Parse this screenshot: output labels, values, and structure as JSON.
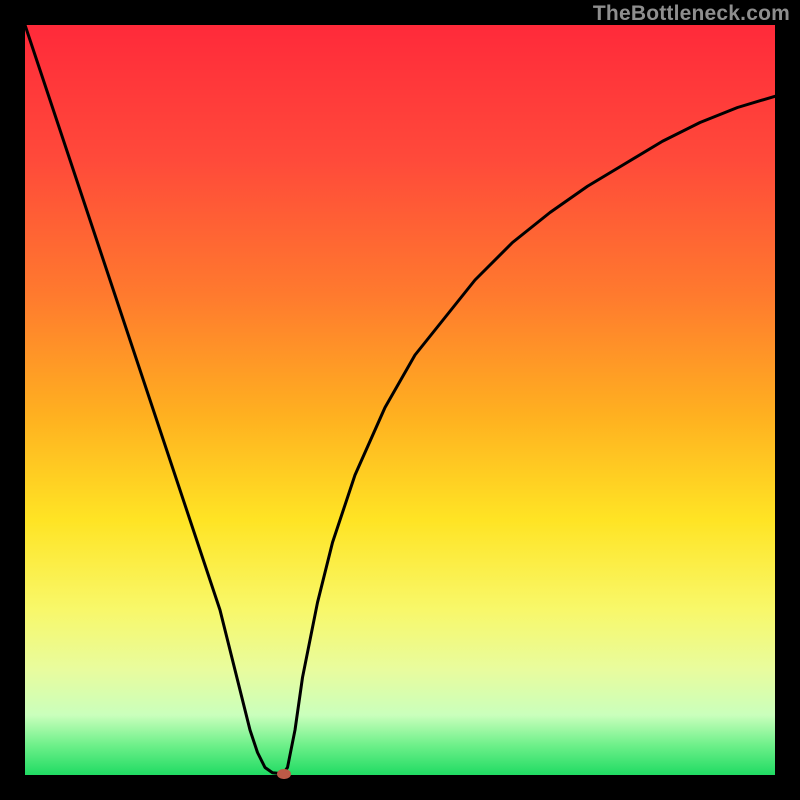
{
  "watermark": {
    "text": "TheBottleneck.com"
  },
  "colors": {
    "frame_bg": "#000000",
    "curve_stroke": "#000000",
    "marker_fill": "#bb5a47",
    "gradient": [
      "#ff2a3a",
      "#ff4a3a",
      "#ff7a2e",
      "#ffb020",
      "#ffe424",
      "#f8f86a",
      "#e8fc9e",
      "#caffbc",
      "#6ef08a",
      "#20db63"
    ]
  },
  "chart_data": {
    "type": "line",
    "title": "",
    "xlabel": "",
    "ylabel": "",
    "xlim": [
      0,
      1
    ],
    "ylim": [
      0,
      1
    ],
    "x": [
      0.0,
      0.02,
      0.04,
      0.06,
      0.08,
      0.1,
      0.12,
      0.14,
      0.16,
      0.18,
      0.2,
      0.22,
      0.24,
      0.26,
      0.28,
      0.29,
      0.3,
      0.31,
      0.32,
      0.33,
      0.34,
      0.345,
      0.35,
      0.36,
      0.37,
      0.39,
      0.41,
      0.44,
      0.48,
      0.52,
      0.56,
      0.6,
      0.65,
      0.7,
      0.75,
      0.8,
      0.85,
      0.9,
      0.95,
      1.0
    ],
    "values": [
      1.0,
      0.94,
      0.88,
      0.82,
      0.76,
      0.7,
      0.64,
      0.58,
      0.52,
      0.46,
      0.4,
      0.34,
      0.28,
      0.22,
      0.14,
      0.1,
      0.06,
      0.03,
      0.01,
      0.003,
      0.002,
      0.003,
      0.01,
      0.06,
      0.13,
      0.23,
      0.31,
      0.4,
      0.49,
      0.56,
      0.61,
      0.66,
      0.71,
      0.75,
      0.785,
      0.815,
      0.845,
      0.87,
      0.89,
      0.905
    ],
    "marker": {
      "x": 0.345,
      "y": 0.002
    },
    "notes": "Qualitative V-shaped bottleneck curve rendered over rainbow gradient; x and y are normalized 0..1; no numeric axes are shown."
  }
}
